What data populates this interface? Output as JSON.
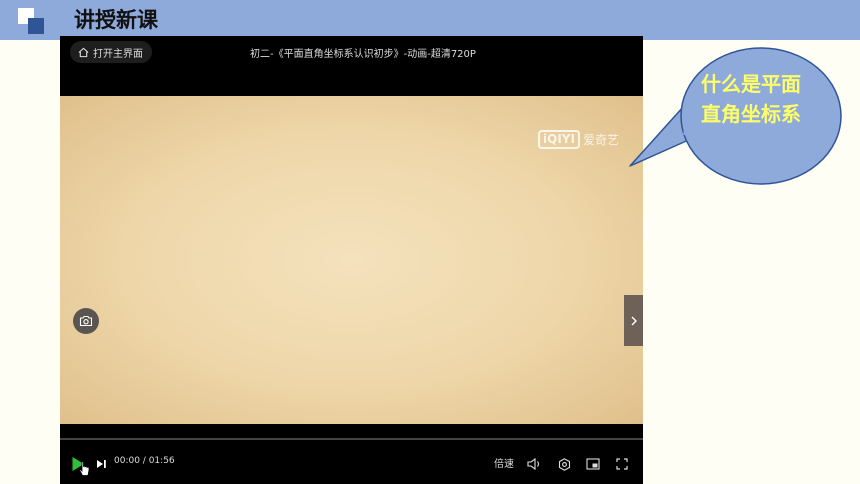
{
  "slide": {
    "title": "讲授新课",
    "bubble_lines": [
      "什么是平面",
      "直角坐标系"
    ]
  },
  "player": {
    "open_home_label": "打开主界面",
    "video_title": "初二-《平面直角坐标系认识初步》-动画-超清720P",
    "watermark_text": "爱奇艺",
    "watermark_logo": "iQIYI",
    "current_time": "00:00",
    "duration": "01:56",
    "time_separator": " / ",
    "speed_label": "倍速",
    "progress": 0.0,
    "icons": [
      "home-icon",
      "camera-icon",
      "chevron-right-icon",
      "play-icon",
      "next-icon",
      "volume-icon",
      "settings-icon",
      "picture-in-picture-icon",
      "fullscreen-icon",
      "cursor-icon"
    ]
  },
  "colors": {
    "header_band": "#8eaadb",
    "logo_dark": "#2f5597",
    "bubble_fill": "#8eaadb",
    "bubble_text": "#ffff66",
    "play_accent": "#2fbf3c",
    "video_bg": "#efd9ae"
  }
}
